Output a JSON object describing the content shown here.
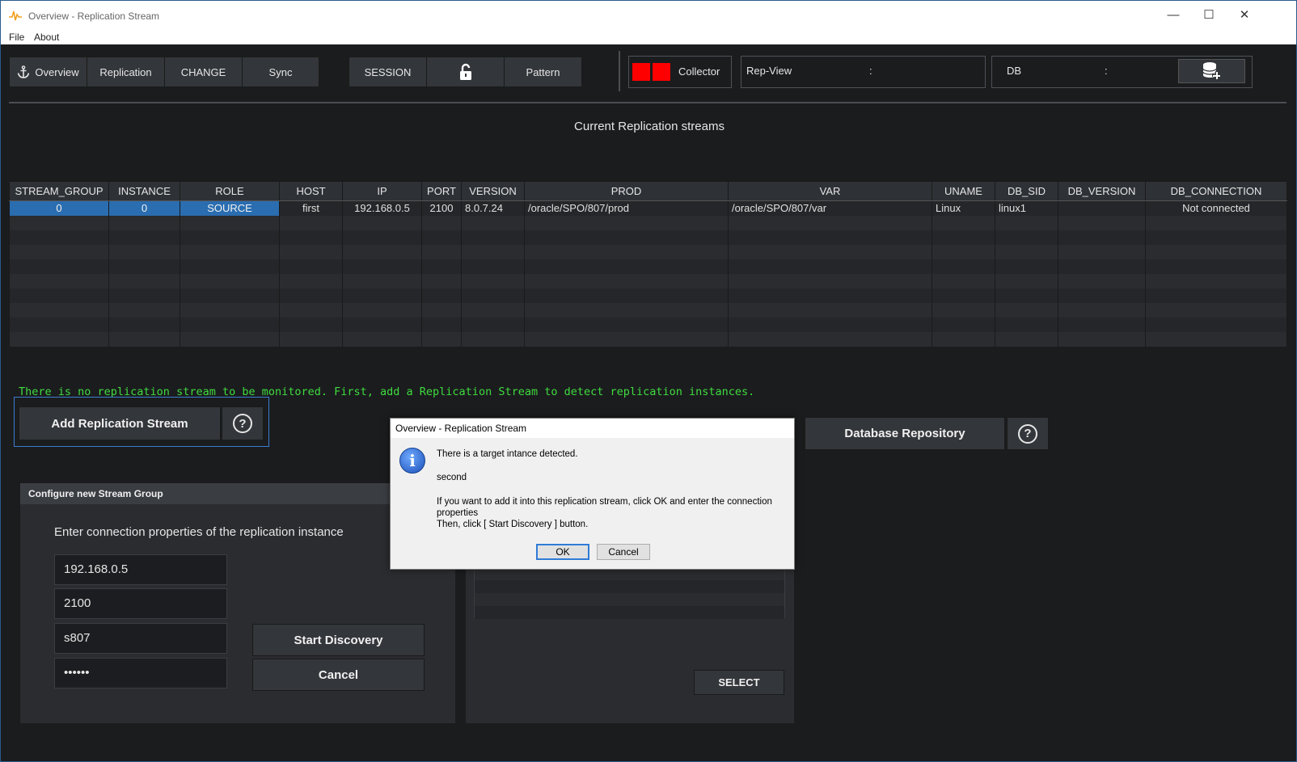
{
  "window": {
    "title": "Overview - Replication Stream",
    "controls": {
      "minimize": "—",
      "maximize": "☐",
      "close": "✕"
    }
  },
  "menu": {
    "file": "File",
    "about": "About"
  },
  "toolbar": {
    "overview": "Overview",
    "replication": "Replication",
    "change": "CHANGE",
    "sync": "Sync",
    "session": "SESSION",
    "pattern": "Pattern",
    "collector": "Collector",
    "collector_status_color": "#ff0000",
    "repview_label": "Rep-View",
    "repview_sep": ":",
    "db_label": "DB",
    "db_sep": ":"
  },
  "heading": "Current Replication streams",
  "table": {
    "columns": [
      "STREAM_GROUP",
      "INSTANCE",
      "ROLE",
      "HOST",
      "IP",
      "PORT",
      "VERSION",
      "PROD",
      "VAR",
      "UNAME",
      "DB_SID",
      "DB_VERSION",
      "DB_CONNECTION"
    ],
    "rows": [
      [
        "0",
        "0",
        "SOURCE",
        "first",
        "192.168.0.5",
        "2100",
        "8.0.7.24",
        "/oracle/SPO/807/prod",
        "/oracle/SPO/807/var",
        "Linux",
        "linux1",
        "",
        "Not connected"
      ]
    ]
  },
  "info_message": "There is no replication stream to be monitored. First, add a Replication Stream to detect replication instances.",
  "buttons": {
    "add_stream": "Add Replication Stream",
    "db_repository": "Database Repository",
    "help": "?"
  },
  "config_panel": {
    "title": "Configure new Stream Group",
    "prompt": "Enter connection properties of the replication instance",
    "ip": "192.168.0.5",
    "port": "2100",
    "user": "s807",
    "password": "••••••",
    "start_discovery": "Start Discovery",
    "cancel": "Cancel"
  },
  "right_panel": {
    "select": "SELECT"
  },
  "dialog": {
    "title": "Overview - Replication Stream",
    "line1": "There is a target intance detected.",
    "line2": "second",
    "line3": "If you want to add it into this replication stream, click OK and enter the connection properties",
    "line4": "Then, click [ Start Discovery ] button.",
    "ok": "OK",
    "cancel": "Cancel"
  }
}
